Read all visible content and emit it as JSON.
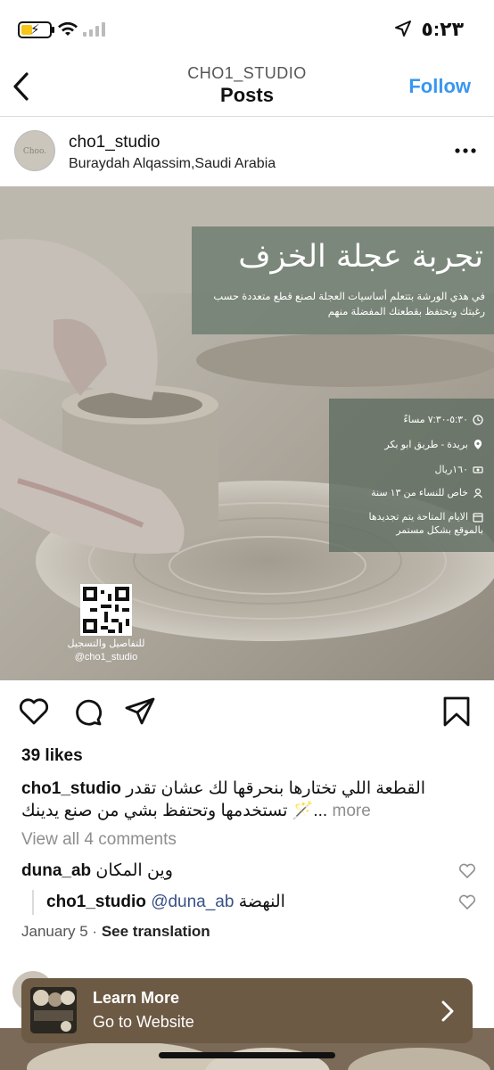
{
  "status_bar": {
    "time": "٥:٢٣"
  },
  "header": {
    "account_label": "CHO1_STUDIO",
    "title": "Posts",
    "follow_label": "Follow"
  },
  "post": {
    "username": "cho1_studio",
    "location": "Buraydah Alqassim,Saudi Arabia",
    "avatar_text": "Choo.",
    "image": {
      "title": "تجربة عجلة الخزف",
      "description": "في هذي الورشة بتتعلم أساسيات العجلة لصنع قطع متعددة حسب رغبتك وتحتفظ بقطعتك المفضلة منهم",
      "info": [
        {
          "icon": "clock-icon",
          "text": "٥:٣٠-٧:٣٠ مساءً"
        },
        {
          "icon": "pin-icon",
          "text": "بريدة - طريق ابو بكر"
        },
        {
          "icon": "money-icon",
          "text": "١٦٠ريال"
        },
        {
          "icon": "person-icon",
          "text": "خاص للنساء من ١٣ سنة"
        },
        {
          "icon": "calendar-icon",
          "text": "الايام المتاحة يتم تجديدها بالموقع بشكل مستمر"
        }
      ],
      "qr_caption_line1": "للتفاصيل والتسجيل",
      "qr_caption_line2": "@cho1_studio"
    },
    "likes": "39 likes",
    "caption_user": "cho1_studio",
    "caption_text_line1": "القطعة اللي تختارها بنحرقها لك عشان تقدر",
    "caption_text_line2": "تستخدمها وتحتفظ بشي من صنع يدينك 🪄...",
    "more_label": "more",
    "view_comments": "View all 4 comments",
    "comments": [
      {
        "user": "duna_ab",
        "text": "وين المكان"
      },
      {
        "user": "cho1_studio",
        "mention": "@duna_ab",
        "text": "النهضة"
      }
    ],
    "date": "January 5",
    "separator": "·",
    "see_translation": "See translation"
  },
  "ad": {
    "title": "Learn More",
    "subtitle": "Go to Website"
  },
  "colors": {
    "follow": "#3897f0",
    "ad_bg": "#6d5a44",
    "overlay": "#6e7d70"
  }
}
